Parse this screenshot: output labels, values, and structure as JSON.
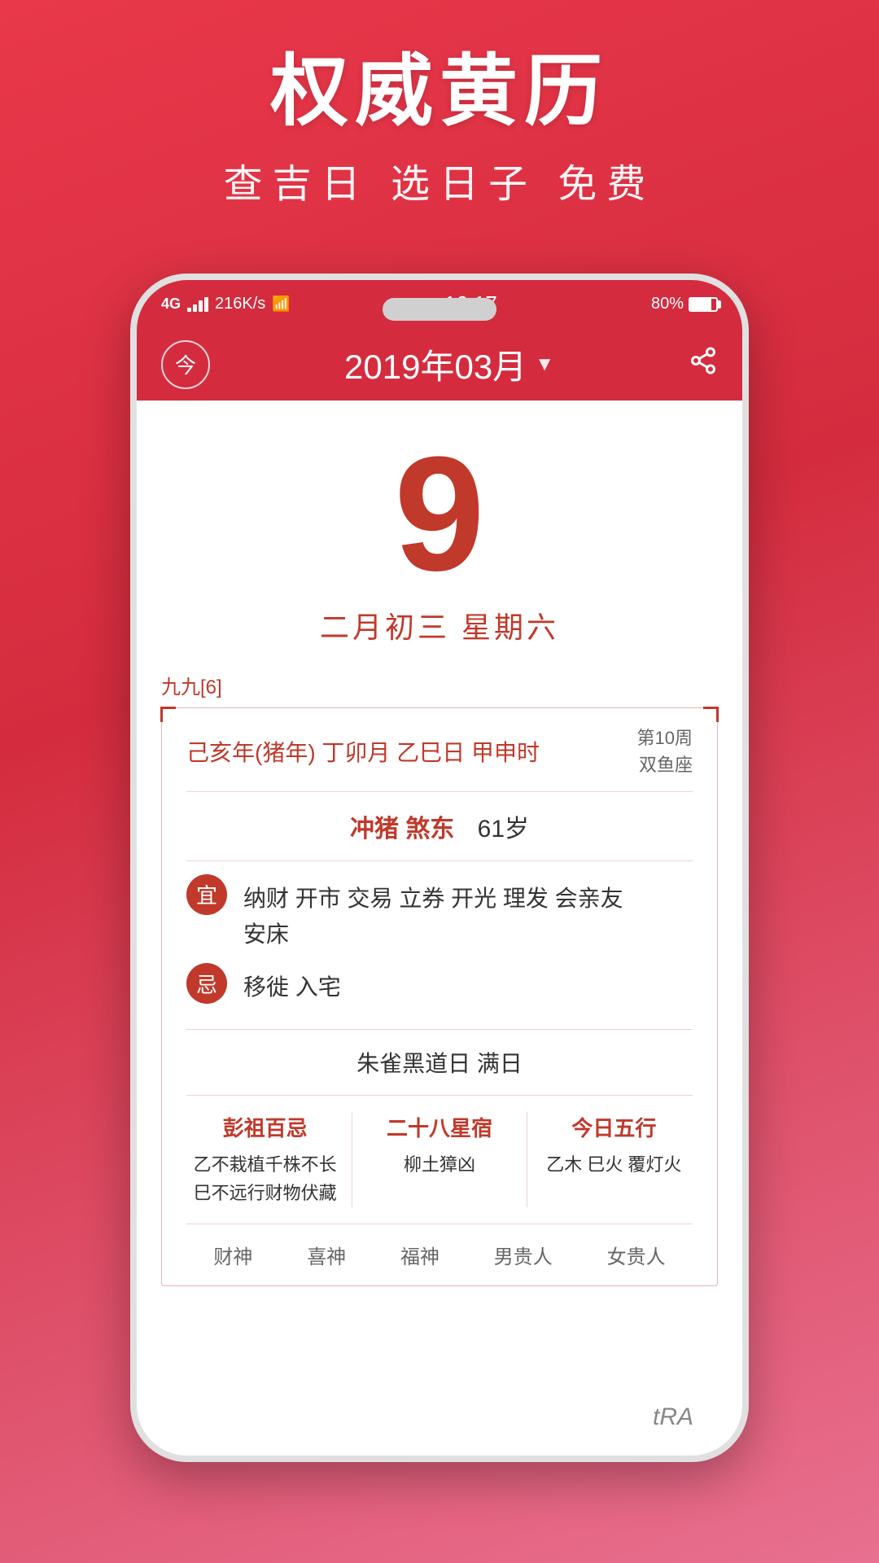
{
  "app": {
    "main_title": "权威黄历",
    "sub_title": "查吉日 选日子 免费"
  },
  "status_bar": {
    "network": "4G",
    "speed": "216K/s",
    "time": "16:17",
    "battery": "80%"
  },
  "header": {
    "today_label": "今",
    "month_title": "2019年03月",
    "dropdown_arrow": "▼",
    "share_icon": "share"
  },
  "date": {
    "day": "9",
    "lunar": "二月初三  星期六"
  },
  "panel": {
    "nine_nine": "九九[6]",
    "ganzhi": "己亥年(猪年) 丁卯月  乙巳日  甲申时",
    "week": "第10周",
    "zodiac": "双鱼座",
    "chong_label": "冲猪",
    "sha_label": "煞东",
    "age": "61岁",
    "yi_badge": "宜",
    "yi_content": "纳财 开市 交易 立券 开光 理发 会亲友\n安床",
    "ji_badge": "忌",
    "ji_content": "移徙 入宅",
    "zhuri": "朱雀黑道日   满日",
    "pengzu_title": "彭祖百忌",
    "pengzu_line1": "乙不栽植千株不长",
    "pengzu_line2": "巳不远行财物伏藏",
    "xingxiu_title": "二十八星宿",
    "xingxiu_content": "柳土獐凶",
    "wuxing_title": "今日五行",
    "wuxing_content": "乙木 巳火 覆灯火",
    "footer_items": [
      "财神",
      "喜神",
      "福神",
      "男贵人",
      "女贵人"
    ],
    "bottom_label": "tRA"
  }
}
